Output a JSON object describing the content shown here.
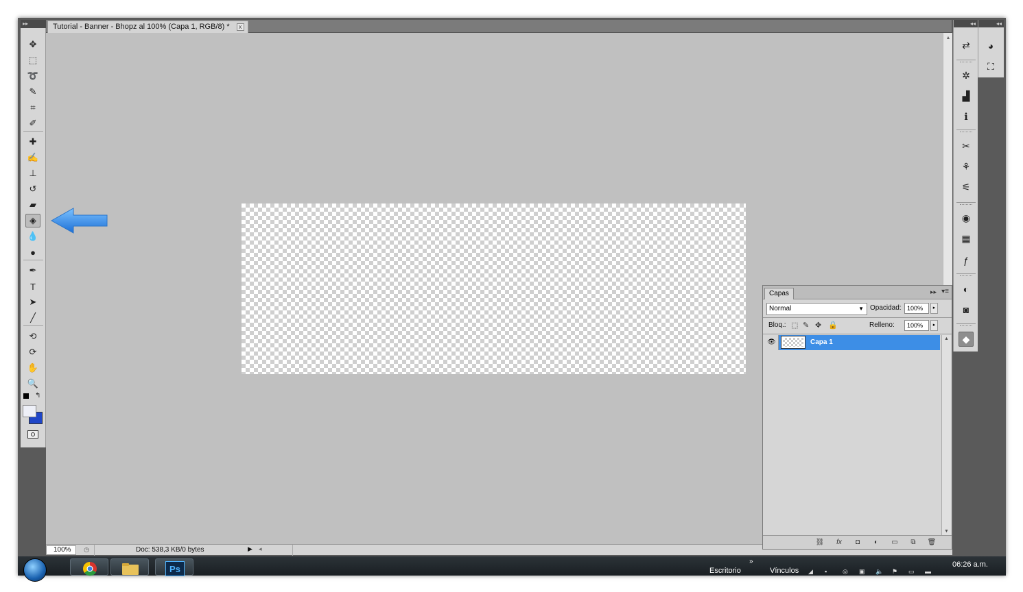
{
  "document": {
    "tab_title": "Tutorial - Banner - Bhopz al 100% (Capa 1, RGB/8) *",
    "tab_close": "x"
  },
  "status": {
    "zoom": "100%",
    "doc_info": "Doc: 538,3 KB/0 bytes"
  },
  "tools": [
    {
      "name": "move-tool",
      "icon": "move-icon",
      "glyph": "✥",
      "active": false
    },
    {
      "name": "marquee-tool",
      "icon": "rect-marquee-icon",
      "glyph": "⬚",
      "active": false
    },
    {
      "name": "lasso-tool",
      "icon": "lasso-icon",
      "glyph": "➰",
      "active": false
    },
    {
      "name": "quick-selection-tool",
      "icon": "quick-select-icon",
      "glyph": "✎",
      "active": false
    },
    {
      "name": "crop-tool",
      "icon": "crop-icon",
      "glyph": "⌗",
      "active": false
    },
    {
      "name": "eyedropper-tool",
      "icon": "eyedropper-icon",
      "glyph": "✐",
      "active": false
    },
    {
      "name": "healing-brush-tool",
      "icon": "bandage-icon",
      "glyph": "✚",
      "active": false
    },
    {
      "name": "brush-tool",
      "icon": "brush-icon",
      "glyph": "✍",
      "active": false
    },
    {
      "name": "clone-stamp-tool",
      "icon": "stamp-icon",
      "glyph": "⊥",
      "active": false
    },
    {
      "name": "history-brush-tool",
      "icon": "history-brush-icon",
      "glyph": "↺",
      "active": false
    },
    {
      "name": "eraser-tool",
      "icon": "eraser-icon",
      "glyph": "▰",
      "active": false
    },
    {
      "name": "paint-bucket-tool",
      "icon": "paint-bucket-icon",
      "glyph": "◈",
      "active": true
    },
    {
      "name": "blur-tool",
      "icon": "drop-icon",
      "glyph": "💧",
      "active": false
    },
    {
      "name": "dodge-tool",
      "icon": "dodge-icon",
      "glyph": "●",
      "active": false
    },
    {
      "name": "pen-tool",
      "icon": "pen-icon",
      "glyph": "✒",
      "active": false
    },
    {
      "name": "type-tool",
      "icon": "type-icon",
      "glyph": "T",
      "active": false
    },
    {
      "name": "path-selection-tool",
      "icon": "arrow-icon",
      "glyph": "➤",
      "active": false
    },
    {
      "name": "line-tool",
      "icon": "line-icon",
      "glyph": "╱",
      "active": false
    },
    {
      "name": "3d-rotate-tool",
      "icon": "3d-rotate-icon",
      "glyph": "⟲",
      "active": false
    },
    {
      "name": "3d-orbit-tool",
      "icon": "3d-orbit-icon",
      "glyph": "⟳",
      "active": false
    },
    {
      "name": "hand-tool",
      "icon": "hand-icon",
      "glyph": "✋",
      "active": false
    },
    {
      "name": "zoom-tool",
      "icon": "zoom-icon",
      "glyph": "🔍",
      "active": false
    }
  ],
  "colors": {
    "foreground": "#eef0f8",
    "background": "#1f46c8",
    "selection": "#3d8ee6",
    "annotation_arrow": "#3a8fe8"
  },
  "dock_icons": [
    {
      "name": "mini-bridge-icon",
      "glyph": "⇄"
    },
    {
      "name": "navigator-icon",
      "glyph": "✲"
    },
    {
      "name": "histogram-icon",
      "glyph": "▟"
    },
    {
      "name": "info-icon",
      "glyph": "ℹ"
    },
    {
      "name": "tool-presets-icon",
      "glyph": "✂"
    },
    {
      "name": "brush-presets-icon",
      "glyph": "⚘"
    },
    {
      "name": "clone-source-icon",
      "glyph": "⚟"
    },
    {
      "name": "color-icon",
      "glyph": "◉"
    },
    {
      "name": "swatches-icon",
      "glyph": "▦"
    },
    {
      "name": "styles-icon",
      "glyph": "ƒ"
    },
    {
      "name": "adjustments-icon",
      "glyph": "◐"
    },
    {
      "name": "masks-icon",
      "glyph": "◙"
    },
    {
      "name": "layers-icon",
      "glyph": "◆"
    }
  ],
  "dock2_icons": [
    {
      "name": "3d-icon",
      "glyph": "◕"
    },
    {
      "name": "transform-icon",
      "glyph": "⛶"
    }
  ],
  "layers_panel": {
    "tab": "Capas",
    "blend_mode": "Normal",
    "opacity_label": "Opacidad:",
    "opacity_value": "100%",
    "lock_label": "Bloq.:",
    "fill_label": "Relleno:",
    "fill_value": "100%",
    "layers": [
      {
        "name": "Capa 1",
        "visible": true,
        "selected": true
      }
    ],
    "footer_icons": [
      "link-icon",
      "fx-icon",
      "mask-icon",
      "adjustment-icon",
      "group-icon",
      "new-layer-icon",
      "trash-icon"
    ]
  },
  "taskbar": {
    "apps": [
      {
        "name": "chrome",
        "icon": "chrome-icon"
      },
      {
        "name": "explorer",
        "icon": "folder-icon"
      },
      {
        "name": "photoshop",
        "icon": "photoshop-icon",
        "label": "Ps"
      }
    ],
    "toolbar_desktop": "Escritorio",
    "toolbar_links": "Vínculos",
    "clock": "06:26 a.m."
  }
}
